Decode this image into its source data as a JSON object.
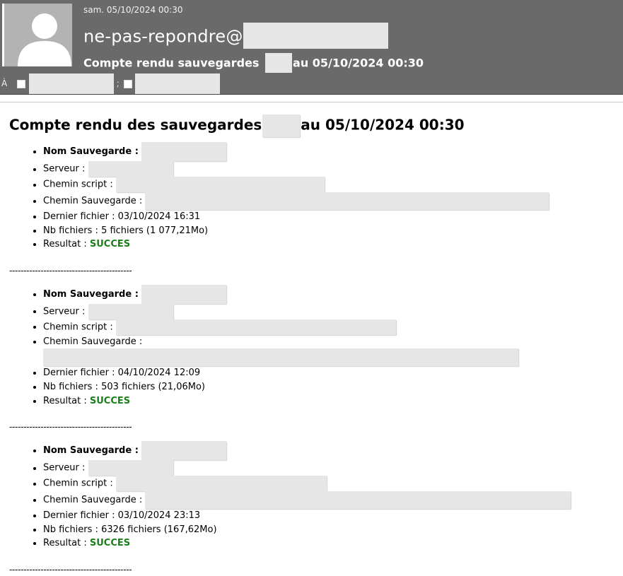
{
  "header": {
    "date": "sam. 05/10/2024 00:30",
    "sender": "ne-pas-repondre@",
    "subject_prefix": "Compte rendu sauvegardes",
    "subject_suffix": "au 05/10/2024 00:30",
    "to_label": "À"
  },
  "title": {
    "prefix": "Compte rendu des sauvegardes",
    "suffix": "au 05/10/2024 00:30"
  },
  "labels": {
    "nom": "Nom Sauvegarde :",
    "serveur": "Serveur :",
    "chemin_script": "Chemin script :",
    "chemin_sauvegarde": "Chemin Sauvegarde :",
    "dernier": "Dernier fichier : ",
    "nb": "Nb fichiers : ",
    "resultat": "Resultat : "
  },
  "separator": "-------------------------------------------",
  "backups": [
    {
      "dernier_fichier": "03/10/2024 16:31",
      "nb_fichiers": "5 fichiers (1 077,21Mo)",
      "resultat": "SUCCES"
    },
    {
      "dernier_fichier": "04/10/2024 12:09",
      "nb_fichiers": "503 fichiers (21,06Mo)",
      "resultat": "SUCCES"
    },
    {
      "dernier_fichier": "03/10/2024 23:13",
      "nb_fichiers": "6326 fichiers (167,62Mo)",
      "resultat": "SUCCES"
    }
  ],
  "colors": {
    "header_bg": "#6a6a6a",
    "success": "#1a7f1a",
    "redaction": "#e6e6e6"
  }
}
